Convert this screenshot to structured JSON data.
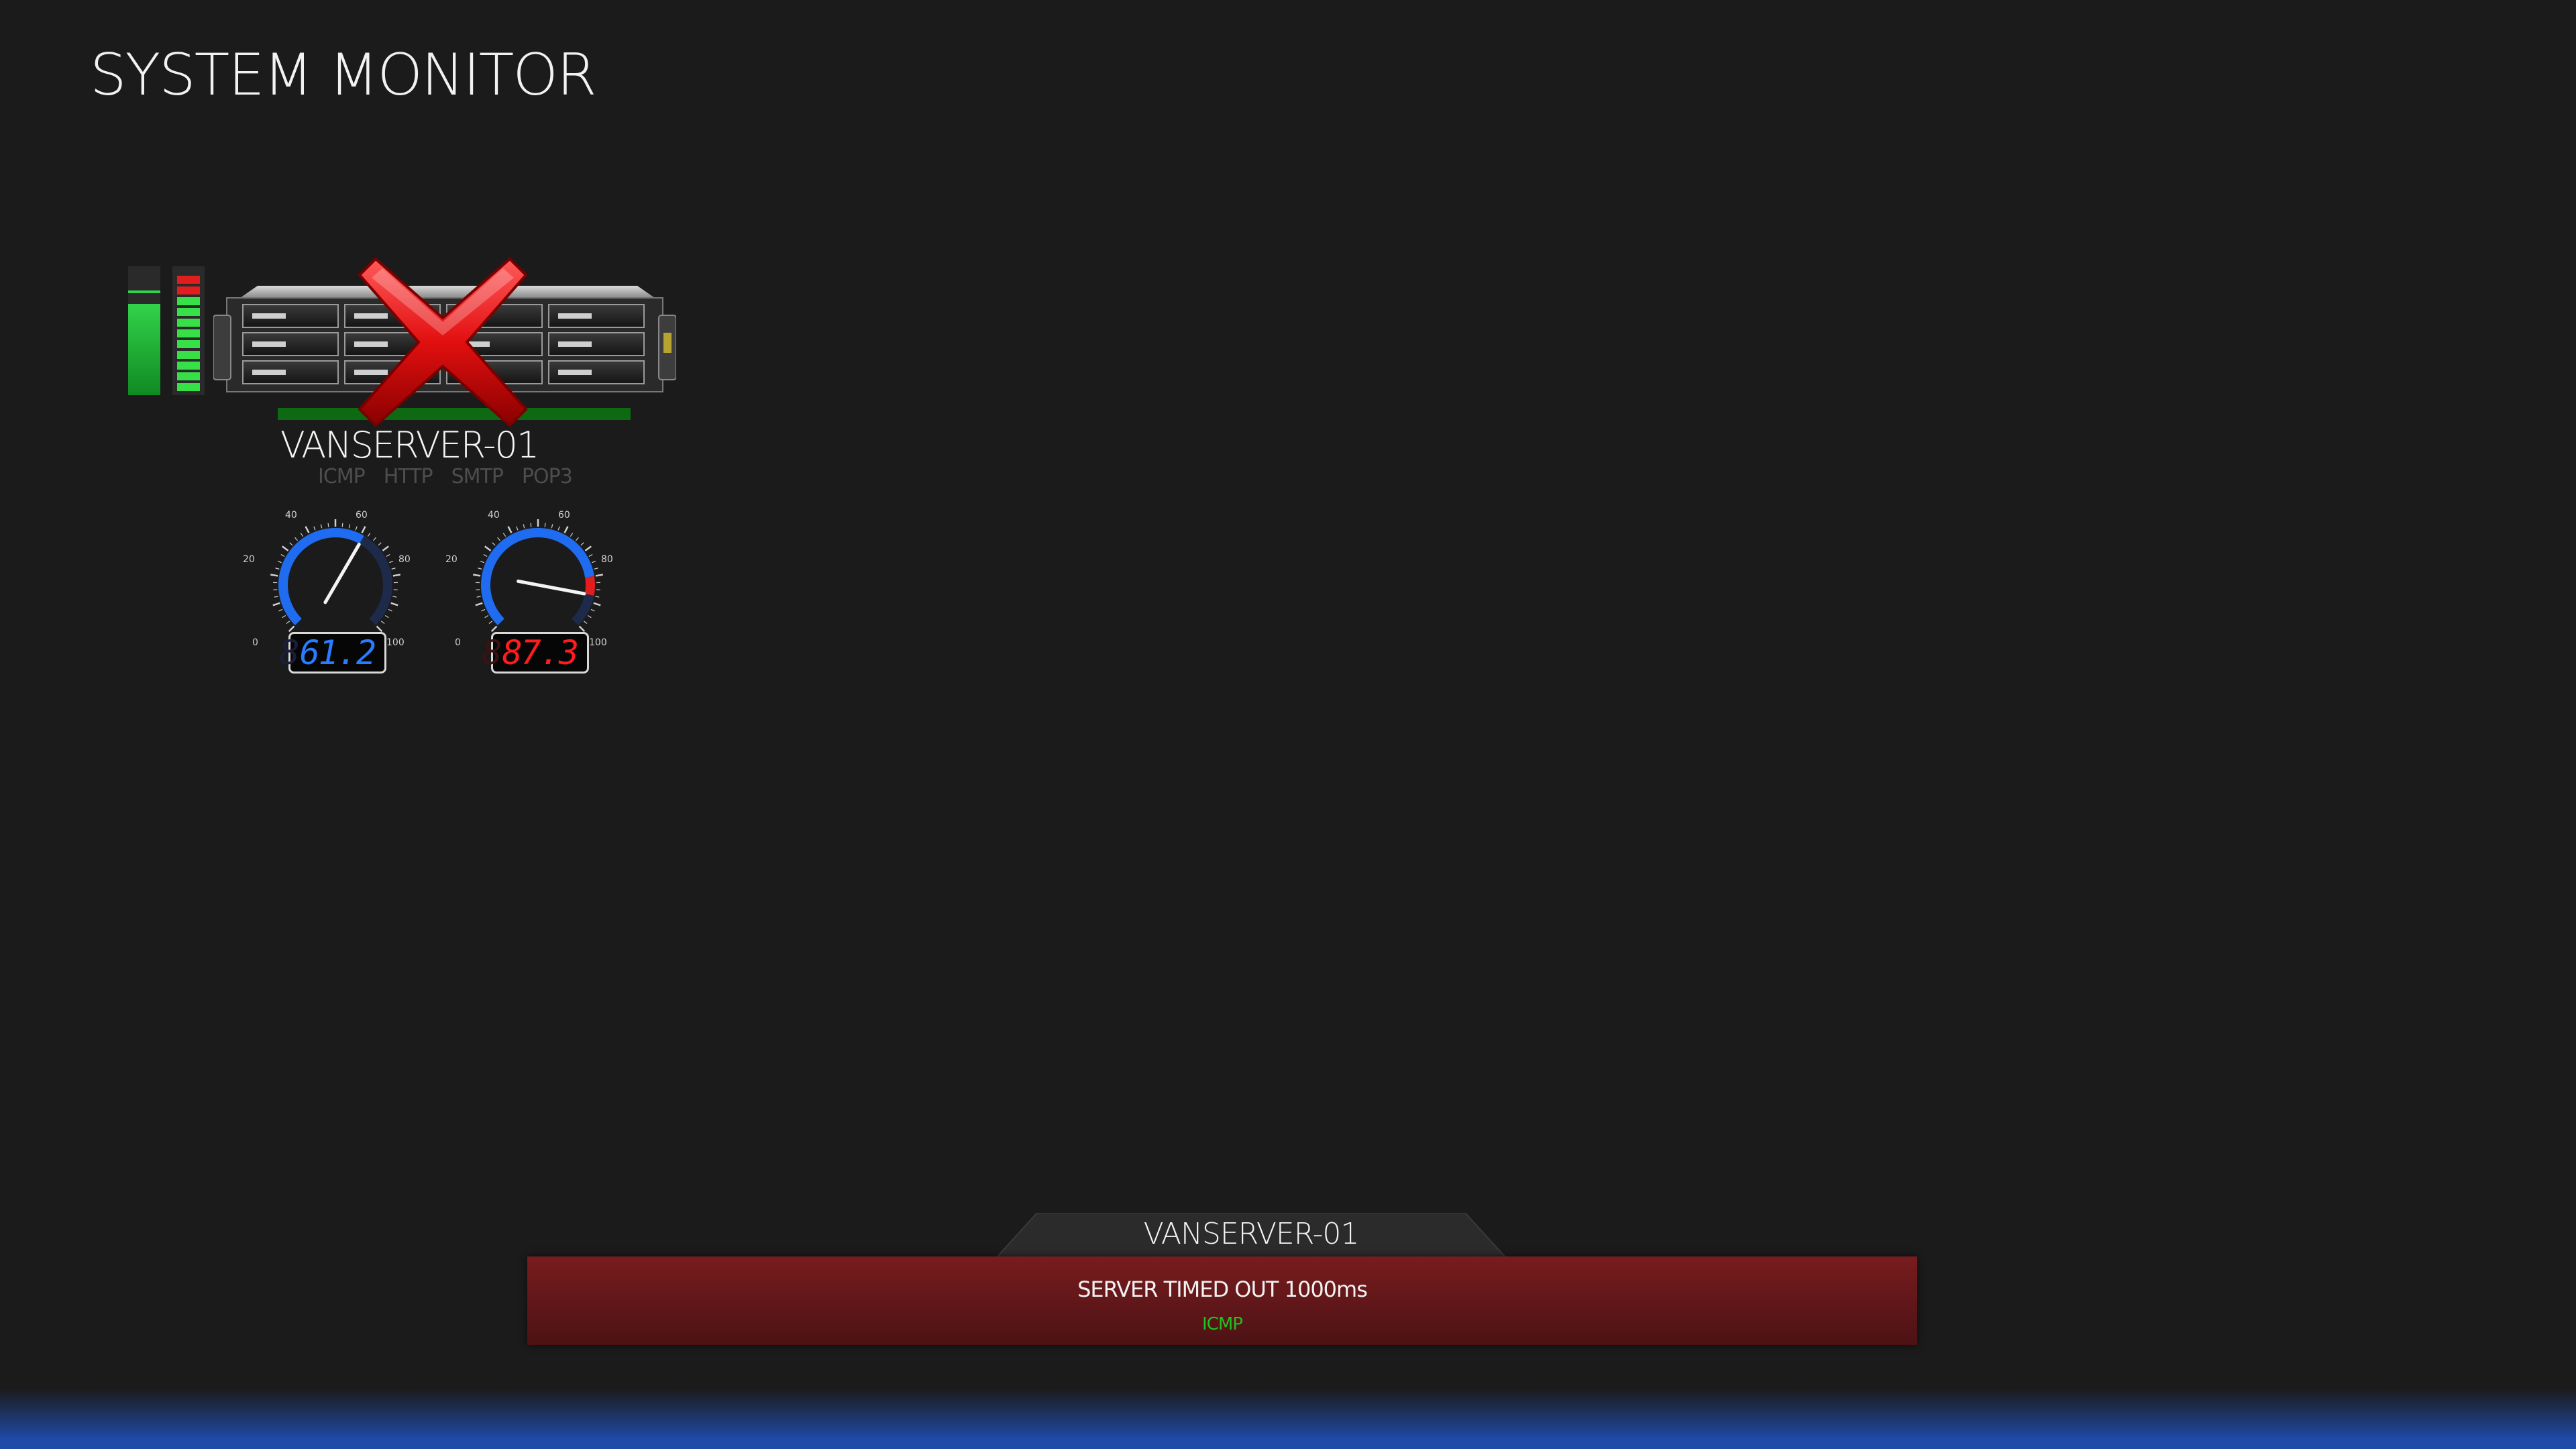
{
  "header": {
    "title": "SYSTEM MONITOR"
  },
  "server": {
    "name": "VANSERVER-01",
    "status": "down",
    "services": [
      "ICMP",
      "HTTP",
      "SMTP",
      "POP3"
    ],
    "gauges": [
      {
        "value": 61.2,
        "readout": "61.2",
        "ghost_digit": "8",
        "color": "#2a7cff",
        "scale": [
          "0",
          "20",
          "40",
          "60",
          "80",
          "100"
        ]
      },
      {
        "value": 87.3,
        "readout": "87.3",
        "ghost_digit": "8",
        "color": "#ff1c1c",
        "scale": [
          "0",
          "20",
          "40",
          "60",
          "80",
          "100"
        ]
      }
    ]
  },
  "alert": {
    "server": "VANSERVER-01",
    "message": "SERVER TIMED OUT 1000ms",
    "service": "ICMP",
    "colors": {
      "background": "#781c1e",
      "service_text": "#1fc21f"
    }
  },
  "colors": {
    "background": "#1b1b1b",
    "accent": "#1f4aa8",
    "status_ok": "#0d6a12",
    "error": "#e21d1d"
  }
}
